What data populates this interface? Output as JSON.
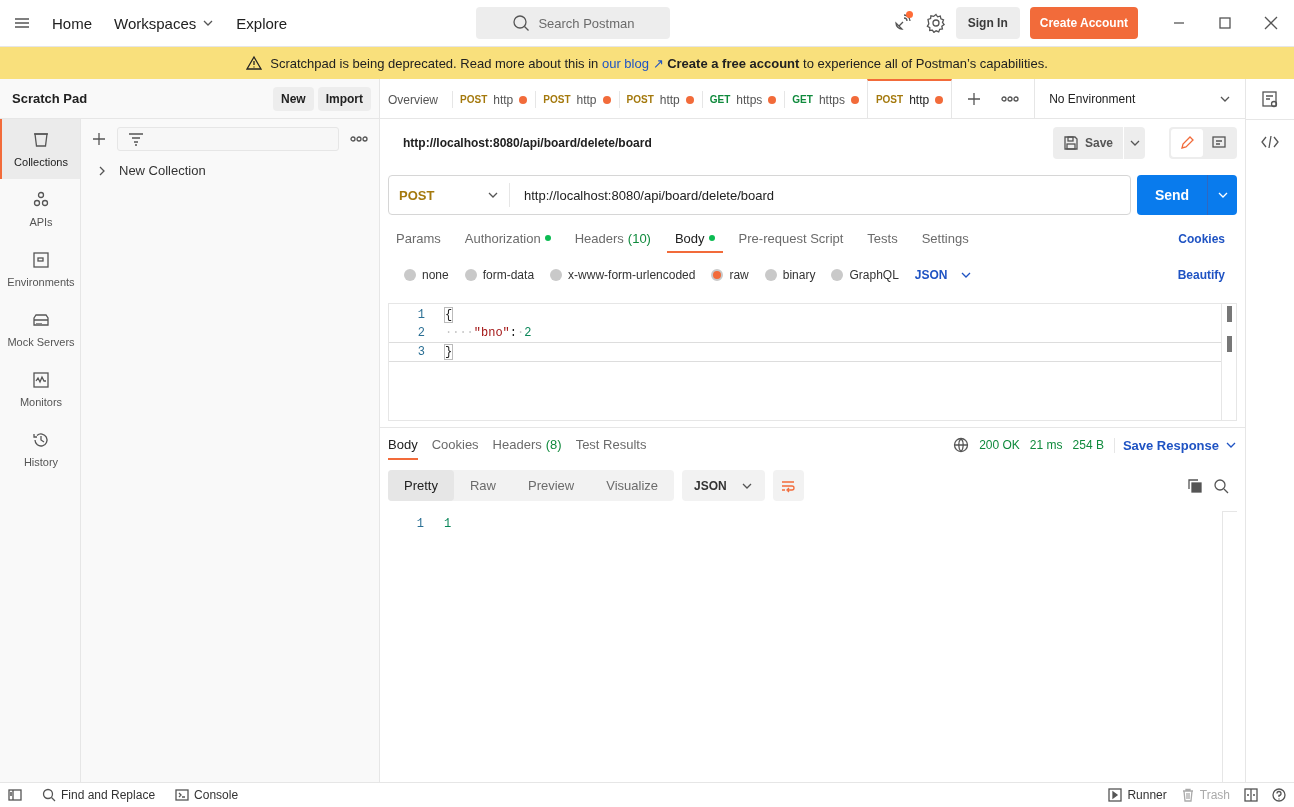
{
  "titlebar": {
    "nav": [
      {
        "label": "Home",
        "menu": false
      },
      {
        "label": "Workspaces",
        "menu": true
      },
      {
        "label": "Explore",
        "menu": false
      }
    ],
    "search": {
      "placeholder": "Search Postman"
    },
    "notification": true,
    "sign_in": "Sign In",
    "create_account": "Create Account"
  },
  "banner": {
    "text": "Scratchpad is being deprecated. Read more about this in ",
    "link": "our blog ↗",
    "rest": "**Create a free account** to experience all of Postman’s capabilities."
  },
  "sidebar": {
    "title": "Scratch Pad",
    "buttons": [
      "New",
      "Import"
    ],
    "nav": [
      {
        "label": "Collections",
        "selected": true
      },
      {
        "label": "APIs",
        "selected": false
      },
      {
        "label": "Environments",
        "selected": false
      },
      {
        "label": "Mock Servers",
        "selected": false
      },
      {
        "label": "Monitors",
        "selected": false
      },
      {
        "label": "History",
        "selected": false
      }
    ],
    "tree": [
      {
        "label": "New Collection",
        "expanded": false
      }
    ]
  },
  "tabs": [
    {
      "kind": "overview",
      "label": "Overview",
      "selected": false
    },
    {
      "kind": "request",
      "method": "POST",
      "color": "#a4790d",
      "label": "http",
      "unsaved": true,
      "selected": false
    },
    {
      "kind": "request",
      "method": "POST",
      "color": "#a4790d",
      "label": "http",
      "unsaved": true,
      "selected": false
    },
    {
      "kind": "request",
      "method": "POST",
      "color": "#a4790d",
      "label": "http",
      "unsaved": true,
      "selected": false
    },
    {
      "kind": "request",
      "method": "GET",
      "color": "#0f8a3c",
      "label": "https",
      "unsaved": true,
      "selected": false
    },
    {
      "kind": "request",
      "method": "GET",
      "color": "#0f8a3c",
      "label": "https",
      "unsaved": true,
      "selected": false
    },
    {
      "kind": "request",
      "method": "POST",
      "color": "#a4790d",
      "label": "http",
      "unsaved": true,
      "selected": true
    }
  ],
  "environment": "No Environment",
  "request": {
    "name": "http://localhost:8080/api/board/delete/board",
    "save": "Save",
    "method": "POST",
    "url": "http://localhost:8080/api/board/delete/board",
    "send": "Send",
    "tabs": [
      {
        "label": "Params",
        "dot": false,
        "selected": false
      },
      {
        "label": "Authorization",
        "dot": true,
        "selected": false
      },
      {
        "label": "Headers",
        "count": "(10)",
        "dot": false,
        "selected": false
      },
      {
        "label": "Body",
        "dot": true,
        "selected": true
      },
      {
        "label": "Pre-request Script",
        "dot": false,
        "selected": false
      },
      {
        "label": "Tests",
        "dot": false,
        "selected": false
      },
      {
        "label": "Settings",
        "dot": false,
        "selected": false
      }
    ],
    "cookies": "Cookies",
    "body_types": [
      {
        "label": "none",
        "selected": false
      },
      {
        "label": "form-data",
        "selected": false
      },
      {
        "label": "x-www-form-urlencoded",
        "selected": false
      },
      {
        "label": "raw",
        "selected": true
      },
      {
        "label": "binary",
        "selected": false
      },
      {
        "label": "GraphQL",
        "selected": false
      }
    ],
    "format": "JSON",
    "beautify": "Beautify",
    "lines": [
      {
        "number": "1",
        "tokens": [
          {
            "kind": "bracket",
            "text": "{"
          }
        ]
      },
      {
        "number": "2",
        "tokens": [
          {
            "kind": "space",
            "text": "····"
          },
          {
            "kind": "key",
            "text": "\"bno\""
          },
          {
            "kind": "punct",
            "text": ":"
          },
          {
            "kind": "space",
            "text": "·"
          },
          {
            "kind": "number",
            "text": "2"
          }
        ]
      },
      {
        "number": "3",
        "tokens": [
          {
            "kind": "bracket",
            "text": "}"
          }
        ]
      }
    ]
  },
  "response": {
    "tabs": [
      {
        "label": "Body",
        "selected": true
      },
      {
        "label": "Cookies",
        "selected": false
      },
      {
        "label": "Headers",
        "count": "(8)",
        "selected": false
      },
      {
        "label": "Test Results",
        "selected": false
      }
    ],
    "status": "200 OK",
    "time": "21 ms",
    "size": "254 B",
    "save": "Save Response",
    "views": [
      {
        "label": "Pretty",
        "selected": true
      },
      {
        "label": "Raw",
        "selected": false
      },
      {
        "label": "Preview",
        "selected": false
      },
      {
        "label": "Visualize",
        "selected": false
      }
    ],
    "format": "JSON",
    "lines": [
      {
        "number": "1",
        "tokens": [
          {
            "kind": "number",
            "text": "1"
          }
        ]
      }
    ]
  },
  "status_bar": {
    "left": [
      {
        "label": "Find and Replace"
      },
      {
        "label": "Console"
      }
    ],
    "right": [
      {
        "label": "Runner",
        "disabled": false
      },
      {
        "label": "Trash",
        "disabled": true
      }
    ]
  }
}
